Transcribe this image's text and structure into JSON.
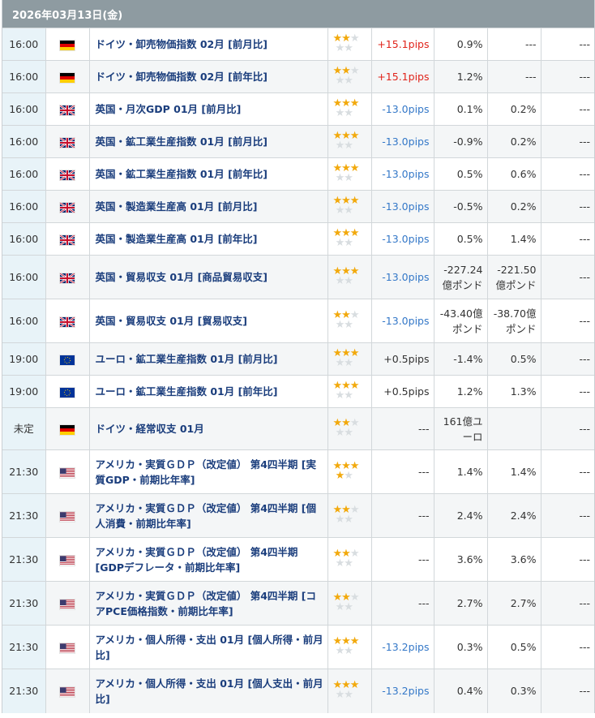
{
  "date": "2026年03月13日(金)",
  "rows": [
    {
      "time": "16:00",
      "flag": "de",
      "name": "ドイツ・卸売物価指数 02月 [前月比]",
      "stars": 2,
      "pips": "+15.1pips",
      "pips_dir": "pos",
      "result": "0.9%",
      "forecast": "---",
      "prev": "---"
    },
    {
      "time": "16:00",
      "flag": "de",
      "name": "ドイツ・卸売物価指数 02月 [前年比]",
      "stars": 2,
      "pips": "+15.1pips",
      "pips_dir": "pos",
      "result": "1.2%",
      "forecast": "---",
      "prev": "---"
    },
    {
      "time": "16:00",
      "flag": "gb",
      "name": "英国・月次GDP 01月 [前月比]",
      "stars": 3,
      "pips": "-13.0pips",
      "pips_dir": "neg",
      "result": "0.1%",
      "forecast": "0.2%",
      "prev": "---"
    },
    {
      "time": "16:00",
      "flag": "gb",
      "name": "英国・鉱工業生産指数 01月 [前月比]",
      "stars": 3,
      "pips": "-13.0pips",
      "pips_dir": "neg",
      "result": "-0.9%",
      "forecast": "0.2%",
      "prev": "---"
    },
    {
      "time": "16:00",
      "flag": "gb",
      "name": "英国・鉱工業生産指数 01月 [前年比]",
      "stars": 3,
      "pips": "-13.0pips",
      "pips_dir": "neg",
      "result": "0.5%",
      "forecast": "0.6%",
      "prev": "---"
    },
    {
      "time": "16:00",
      "flag": "gb",
      "name": "英国・製造業生産高 01月 [前月比]",
      "stars": 3,
      "pips": "-13.0pips",
      "pips_dir": "neg",
      "result": "-0.5%",
      "forecast": "0.2%",
      "prev": "---"
    },
    {
      "time": "16:00",
      "flag": "gb",
      "name": "英国・製造業生産高 01月 [前年比]",
      "stars": 3,
      "pips": "-13.0pips",
      "pips_dir": "neg",
      "result": "0.5%",
      "forecast": "1.4%",
      "prev": "---"
    },
    {
      "time": "16:00",
      "flag": "gb",
      "name": "英国・貿易収支 01月 [商品貿易収支]",
      "stars": 3,
      "pips": "-13.0pips",
      "pips_dir": "neg",
      "result": "-227.24億ポンド",
      "forecast": "-221.50億ポンド",
      "prev": "---"
    },
    {
      "time": "16:00",
      "flag": "gb",
      "name": "英国・貿易収支 01月 [貿易収支]",
      "stars": 2,
      "pips": "-13.0pips",
      "pips_dir": "neg",
      "result": "-43.40億ポンド",
      "forecast": "-38.70億ポンド",
      "prev": "---"
    },
    {
      "time": "19:00",
      "flag": "eu",
      "name": "ユーロ・鉱工業生産指数 01月 [前月比]",
      "stars": 3,
      "pips": "+0.5pips",
      "pips_dir": "plain",
      "result": "-1.4%",
      "forecast": "0.5%",
      "prev": "---"
    },
    {
      "time": "19:00",
      "flag": "eu",
      "name": "ユーロ・鉱工業生産指数 01月 [前年比]",
      "stars": 3,
      "pips": "+0.5pips",
      "pips_dir": "plain",
      "result": "1.2%",
      "forecast": "1.3%",
      "prev": "---"
    },
    {
      "time": "未定",
      "flag": "de",
      "name": "ドイツ・経常収支 01月",
      "stars": 2,
      "pips": "---",
      "pips_dir": "plain",
      "result": "161億ユーロ",
      "forecast": "",
      "prev": "---"
    },
    {
      "time": "21:30",
      "flag": "us",
      "name": "アメリカ・実質ＧＤＰ（改定値） 第4四半期 [実質GDP・前期比年率]",
      "stars": 4,
      "pips": "---",
      "pips_dir": "plain",
      "result": "1.4%",
      "forecast": "1.4%",
      "prev": "---"
    },
    {
      "time": "21:30",
      "flag": "us",
      "name": "アメリカ・実質ＧＤＰ（改定値） 第4四半期 [個人消費・前期比年率]",
      "stars": 2,
      "pips": "---",
      "pips_dir": "plain",
      "result": "2.4%",
      "forecast": "2.4%",
      "prev": "---"
    },
    {
      "time": "21:30",
      "flag": "us",
      "name": "アメリカ・実質ＧＤＰ（改定値） 第4四半期 [GDPデフレータ・前期比年率]",
      "stars": 2,
      "pips": "---",
      "pips_dir": "plain",
      "result": "3.6%",
      "forecast": "3.6%",
      "prev": "---"
    },
    {
      "time": "21:30",
      "flag": "us",
      "name": "アメリカ・実質ＧＤＰ（改定値） 第4四半期 [コアPCE価格指数・前期比年率]",
      "stars": 2,
      "pips": "---",
      "pips_dir": "plain",
      "result": "2.7%",
      "forecast": "2.7%",
      "prev": "---"
    },
    {
      "time": "21:30",
      "flag": "us",
      "name": "アメリカ・個人所得・支出 01月 [個人所得・前月比]",
      "stars": 3,
      "pips": "-13.2pips",
      "pips_dir": "neg",
      "result": "0.3%",
      "forecast": "0.5%",
      "prev": "---"
    },
    {
      "time": "21:30",
      "flag": "us",
      "name": "アメリカ・個人所得・支出 01月 [個人支出・前月比]",
      "stars": 3,
      "pips": "-13.2pips",
      "pips_dir": "neg",
      "result": "0.4%",
      "forecast": "0.3%",
      "prev": "---"
    }
  ]
}
